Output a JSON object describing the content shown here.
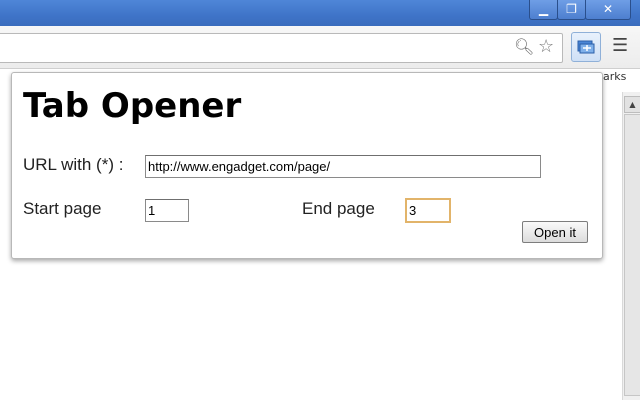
{
  "window": {
    "minimize_glyph": "▁",
    "restore_glyph": "❐",
    "close_glyph": "✕"
  },
  "toolbar": {
    "zoom_icon": "magnifier-icon",
    "star_icon": "star-icon",
    "extension_icon": "tab-opener-extension-icon",
    "menu_glyph": "☰",
    "bookmarks_fragment": "narks"
  },
  "popup": {
    "title": "Tab Opener",
    "url_label": "URL with (*) :",
    "url_value": "http://www.engadget.com/page/",
    "start_label": "Start page",
    "start_value": "1",
    "end_label": "End page",
    "end_value": "3",
    "open_button_label": "Open it"
  },
  "colors": {
    "titlebar": "#3f74c8",
    "focus_ring": "#e2b46a",
    "extension_button": "#cfe0f6"
  }
}
